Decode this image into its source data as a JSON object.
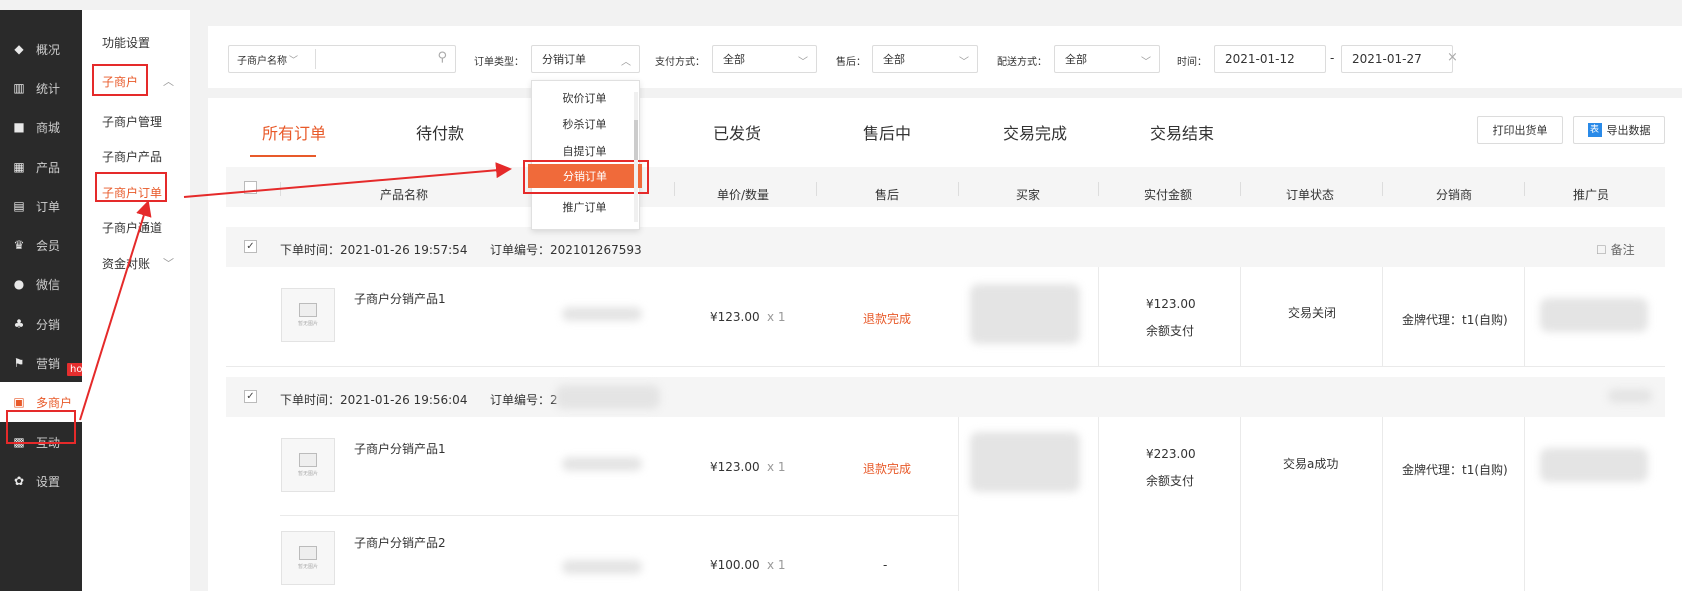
{
  "nav": {
    "items": [
      {
        "icon": "layers-icon",
        "label": "概况"
      },
      {
        "icon": "stats-icon",
        "label": "统计"
      },
      {
        "icon": "mall-icon",
        "label": "商城"
      },
      {
        "icon": "product-icon",
        "label": "产品"
      },
      {
        "icon": "order-icon",
        "label": "订单"
      },
      {
        "icon": "crown-icon",
        "label": "会员"
      },
      {
        "icon": "wechat-icon",
        "label": "微信"
      },
      {
        "icon": "distribution-icon",
        "label": "分销"
      },
      {
        "icon": "flag-icon",
        "label": "营销"
      },
      {
        "icon": "multi-merchant-icon",
        "label": "多商户"
      },
      {
        "icon": "interaction-icon",
        "label": "互动"
      },
      {
        "icon": "gear-icon",
        "label": "设置"
      }
    ],
    "hot_badge": "hot",
    "active_index": 9
  },
  "subnav": {
    "items": [
      {
        "label": "功能设置"
      },
      {
        "label": "子商户"
      },
      {
        "label": "子商户管理"
      },
      {
        "label": "子商户产品"
      },
      {
        "label": "子商户订单"
      },
      {
        "label": "子商户通道"
      },
      {
        "label": "资金对账"
      }
    ]
  },
  "filter": {
    "sub_merchant_select": "子商户名称",
    "order_type_label": "订单类型：",
    "order_type_value": "分销订单",
    "payment_label": "支付方式：",
    "payment_value": "全部",
    "aftersale_label": "售后：",
    "aftersale_value": "全部",
    "delivery_label": "配送方式：",
    "delivery_value": "全部",
    "time_label": "时间：",
    "date_start": "2021-01-12",
    "date_sep": "-",
    "date_end": "2021-01-27",
    "clear": "×"
  },
  "dropdown": {
    "options": [
      "砍价订单",
      "秒杀订单",
      "自提订单",
      "分销订单",
      "推广订单"
    ],
    "selected": "分销订单"
  },
  "tabs": [
    "所有订单",
    "待付款",
    "已发货",
    "售后中",
    "交易完成",
    "交易结束"
  ],
  "actions": {
    "print": "打印出货单",
    "export": "导出数据",
    "export_icon": "表"
  },
  "columns": [
    "产品名称",
    "单价/数量",
    "售后",
    "买家",
    "实付金额",
    "订单状态",
    "分销商",
    "推广员"
  ],
  "remark": "备注",
  "orders": [
    {
      "time": "下单时间：2021-01-26 19:57:54",
      "number": "订单编号：202101267593",
      "products": [
        {
          "name": "子商户分销产品1",
          "price": "¥123.00",
          "qty": "x 1",
          "aftersale": "退款完成"
        }
      ],
      "amount": "¥123.00",
      "pay": "余额支付",
      "status": "交易关闭",
      "distributor": "金牌代理：t1(自购)"
    },
    {
      "time": "下单时间：2021-01-26 19:56:04",
      "number": "订单编号：2",
      "products": [
        {
          "name": "子商户分销产品1",
          "price": "¥123.00",
          "qty": "x 1",
          "aftersale": "退款完成"
        },
        {
          "name": "子商户分销产品2",
          "price": "¥100.00",
          "qty": "x 1",
          "aftersale": "-"
        }
      ],
      "amount": "¥223.00",
      "pay": "余额支付",
      "status": "交易a成功",
      "distributor": "金牌代理：t1(自购)"
    }
  ],
  "thumb_caption": "暂无图片",
  "colors": {
    "accent": "#e85a2a",
    "annotation": "#e52a2a",
    "sidebar": "#2a2a2a"
  }
}
